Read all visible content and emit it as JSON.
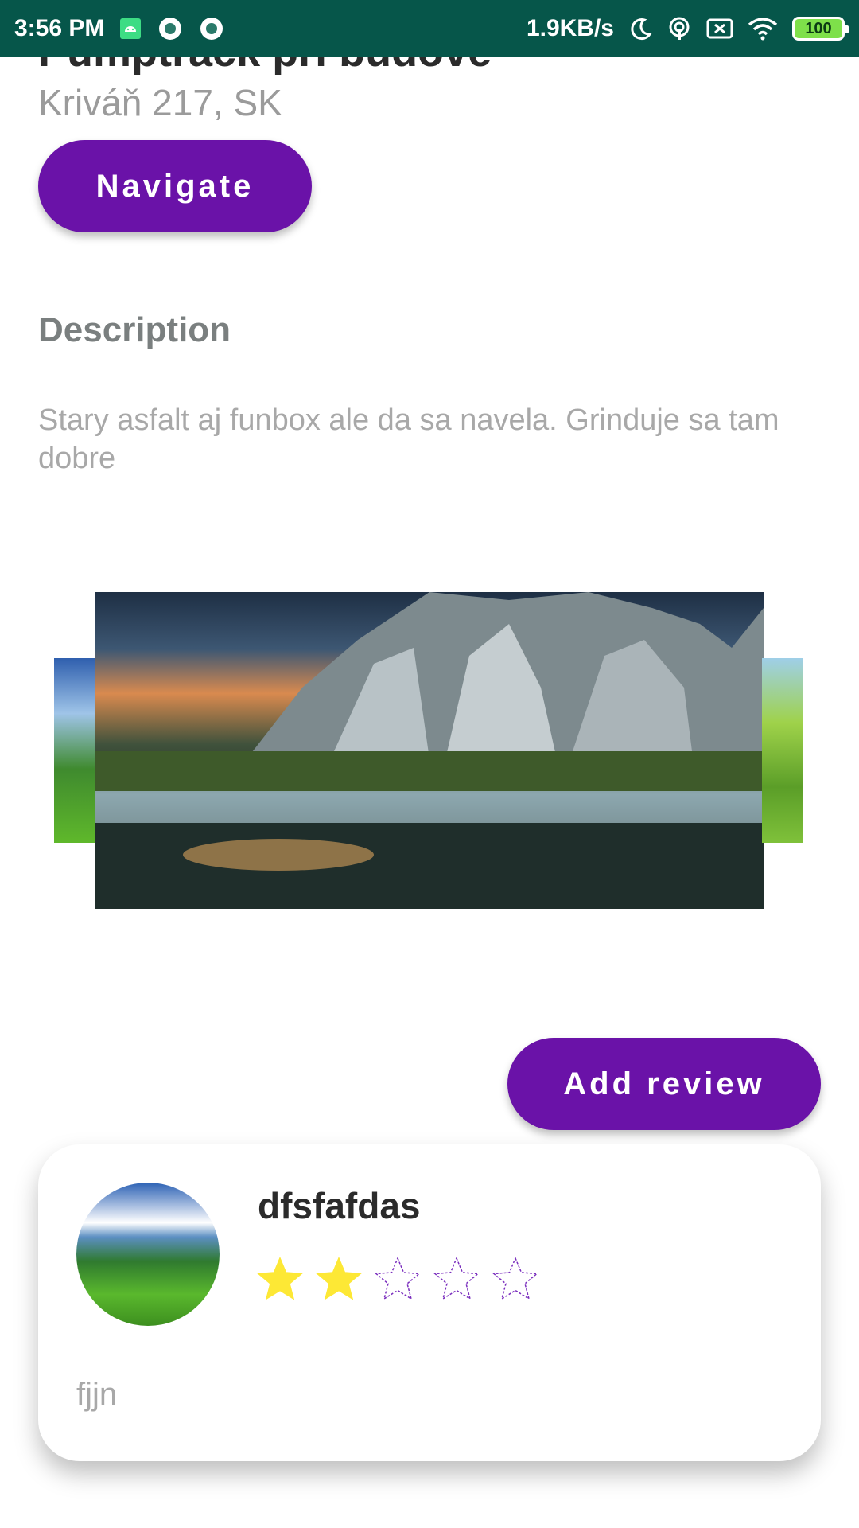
{
  "status_bar": {
    "time": "3:56 PM",
    "net_speed": "1.9KB/s",
    "battery": "100",
    "icons": [
      "android-icon",
      "record-icon",
      "record-icon",
      "moon-icon",
      "hotspot-icon",
      "sim-off-icon",
      "wifi-icon",
      "battery-icon"
    ]
  },
  "place": {
    "title": "Pumptrack pri budove",
    "address": "Kriváň 217, SK",
    "navigate_label": "Navigate"
  },
  "description": {
    "heading": "Description",
    "text": "Stary asfalt aj funbox ale da sa navela. Grinduje sa tam dobre"
  },
  "gallery": {
    "images": [
      "mountain-meadow-image",
      "cliffs-lake-sunset-image",
      "green-forest-image"
    ],
    "active_index": 1
  },
  "reviews": {
    "add_label": "Add review",
    "items": [
      {
        "author": "dfsfafdas",
        "rating": 2,
        "max_rating": 5,
        "text": "fjjn"
      }
    ]
  },
  "colors": {
    "status_bar": "#06564a",
    "accent": "#6a12a8",
    "star_filled": "#fde835",
    "star_empty_outline": "#7b2fbe"
  }
}
